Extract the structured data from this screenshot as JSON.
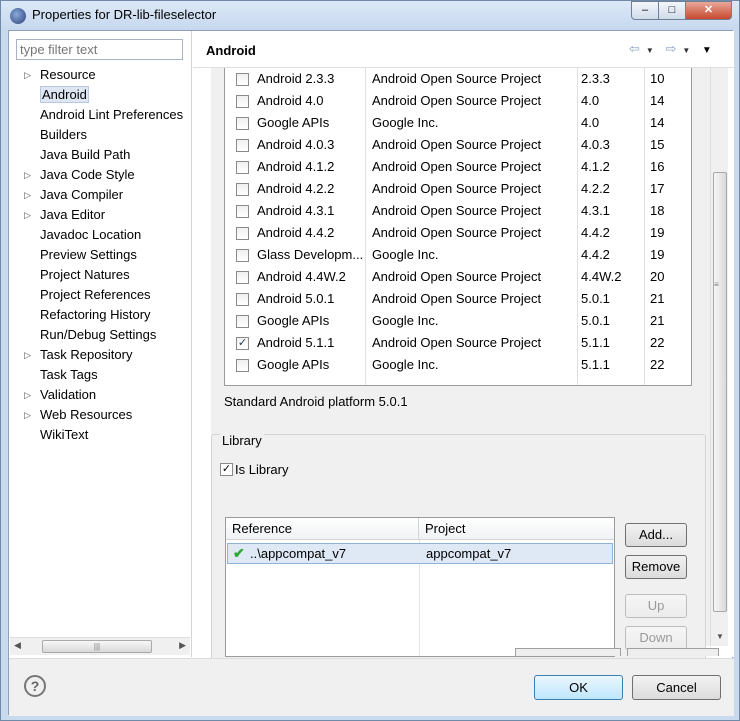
{
  "window": {
    "title": "Properties for DR-lib-fileselector",
    "minimize_glyph": "‒",
    "maximize_glyph": "□",
    "close_glyph": "✕"
  },
  "left": {
    "filter_placeholder": "type filter text",
    "tree": [
      {
        "label": "Resource",
        "expandable": true
      },
      {
        "label": "Android",
        "expandable": false,
        "selected": true
      },
      {
        "label": "Android Lint Preferences",
        "expandable": false
      },
      {
        "label": "Builders",
        "expandable": false
      },
      {
        "label": "Java Build Path",
        "expandable": false
      },
      {
        "label": "Java Code Style",
        "expandable": true
      },
      {
        "label": "Java Compiler",
        "expandable": true
      },
      {
        "label": "Java Editor",
        "expandable": true
      },
      {
        "label": "Javadoc Location",
        "expandable": false
      },
      {
        "label": "Preview Settings",
        "expandable": false
      },
      {
        "label": "Project Natures",
        "expandable": false
      },
      {
        "label": "Project References",
        "expandable": false
      },
      {
        "label": "Refactoring History",
        "expandable": false
      },
      {
        "label": "Run/Debug Settings",
        "expandable": false
      },
      {
        "label": "Task Repository",
        "expandable": true
      },
      {
        "label": "Task Tags",
        "expandable": false
      },
      {
        "label": "Validation",
        "expandable": true
      },
      {
        "label": "Web Resources",
        "expandable": true
      },
      {
        "label": "WikiText",
        "expandable": false
      }
    ]
  },
  "right": {
    "title": "Android",
    "targets": [
      {
        "name": "Android 2.3.3",
        "vendor": "Android Open Source Project",
        "platform": "2.3.3",
        "api": "10",
        "checked": false
      },
      {
        "name": "Android 4.0",
        "vendor": "Android Open Source Project",
        "platform": "4.0",
        "api": "14",
        "checked": false
      },
      {
        "name": "Google APIs",
        "vendor": "Google Inc.",
        "platform": "4.0",
        "api": "14",
        "checked": false
      },
      {
        "name": "Android 4.0.3",
        "vendor": "Android Open Source Project",
        "platform": "4.0.3",
        "api": "15",
        "checked": false
      },
      {
        "name": "Android 4.1.2",
        "vendor": "Android Open Source Project",
        "platform": "4.1.2",
        "api": "16",
        "checked": false
      },
      {
        "name": "Android 4.2.2",
        "vendor": "Android Open Source Project",
        "platform": "4.2.2",
        "api": "17",
        "checked": false
      },
      {
        "name": "Android 4.3.1",
        "vendor": "Android Open Source Project",
        "platform": "4.3.1",
        "api": "18",
        "checked": false
      },
      {
        "name": "Android 4.4.2",
        "vendor": "Android Open Source Project",
        "platform": "4.4.2",
        "api": "19",
        "checked": false
      },
      {
        "name": "Glass Developm...",
        "vendor": "Google Inc.",
        "platform": "4.4.2",
        "api": "19",
        "checked": false
      },
      {
        "name": "Android 4.4W.2",
        "vendor": "Android Open Source Project",
        "platform": "4.4W.2",
        "api": "20",
        "checked": false
      },
      {
        "name": "Android 5.0.1",
        "vendor": "Android Open Source Project",
        "platform": "5.0.1",
        "api": "21",
        "checked": false
      },
      {
        "name": "Google APIs",
        "vendor": "Google Inc.",
        "platform": "5.0.1",
        "api": "21",
        "checked": false
      },
      {
        "name": "Android 5.1.1",
        "vendor": "Android Open Source Project",
        "platform": "5.1.1",
        "api": "22",
        "checked": true
      },
      {
        "name": "Google APIs",
        "vendor": "Google Inc.",
        "platform": "5.1.1",
        "api": "22",
        "checked": false
      }
    ],
    "platform_text": "Standard Android platform 5.0.1",
    "library": {
      "group_label": "Library",
      "is_library_label": "Is Library",
      "is_library_checked": true,
      "columns": [
        "Reference",
        "Project"
      ],
      "rows": [
        {
          "reference": "..\\appcompat_v7",
          "project": "appcompat_v7"
        }
      ],
      "buttons": {
        "add": "Add...",
        "remove": "Remove",
        "up": "Up",
        "down": "Down"
      }
    }
  },
  "bottom": {
    "help_glyph": "?",
    "ok": "OK",
    "cancel": "Cancel"
  },
  "colors": {
    "titlebar": "#c7d8ee",
    "selection": "#dde6f2",
    "check_green": "#2fa82f"
  }
}
